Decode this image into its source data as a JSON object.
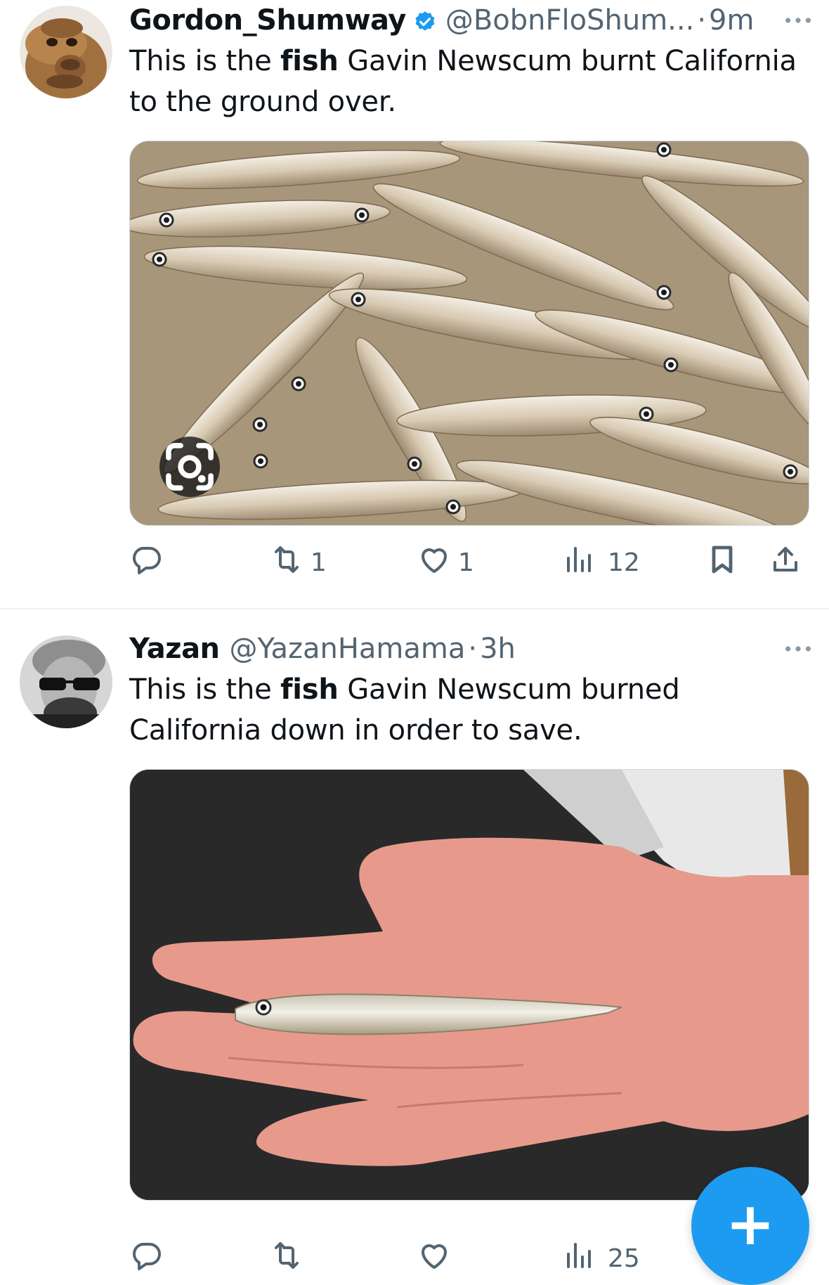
{
  "tweets": [
    {
      "name": "Gordon_Shumway",
      "handle": "@BobnFloShum...",
      "separator": "·",
      "time": "9m",
      "verified": true,
      "text_pre": "This is the ",
      "text_bold": "fish",
      "text_post": " Gavin Newscum burnt California to the ground over.",
      "media_icon": "camera-lens-icon",
      "actions": {
        "reply": "",
        "retweet": "1",
        "like": "1",
        "views": "12"
      }
    },
    {
      "name": "Yazan",
      "handle": "@YazanHamama",
      "separator": "·",
      "time": "3h",
      "verified": false,
      "text_pre": "This is the ",
      "text_bold": "fish",
      "text_post": " Gavin Newscum burned California down in order to save.",
      "actions": {
        "reply": "",
        "retweet": "",
        "like": "",
        "views": "25"
      }
    }
  ],
  "fab": {
    "label": "+",
    "icon": "compose-plus-icon"
  },
  "colors": {
    "accent": "#1d9bf0",
    "muted": "#536471",
    "text": "#0f1419",
    "divider": "#eff3f4"
  }
}
